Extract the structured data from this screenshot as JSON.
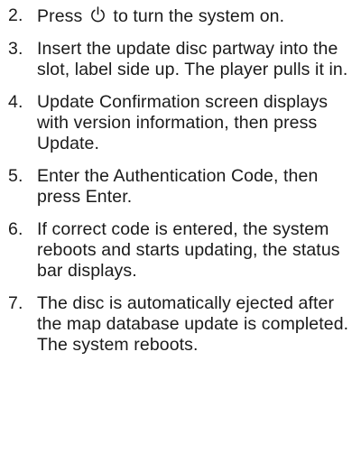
{
  "steps": [
    {
      "number": "2.",
      "text_before_icon": "Press",
      "icon": "power-icon",
      "text_after_icon": "to turn the system on."
    },
    {
      "number": "3.",
      "text": "Insert the update disc partway into the slot, label side up. The player pulls it in."
    },
    {
      "number": "4.",
      "text": "Update Confirmation screen displays with version information, then press Update."
    },
    {
      "number": "5.",
      "text": "Enter the Authentication Code, then press Enter."
    },
    {
      "number": "6.",
      "text": "If correct code is entered, the system reboots and starts updating, the status bar displays."
    },
    {
      "number": "7.",
      "text": "The disc is automatically ejected after the map database update is completed. The system reboots."
    }
  ]
}
